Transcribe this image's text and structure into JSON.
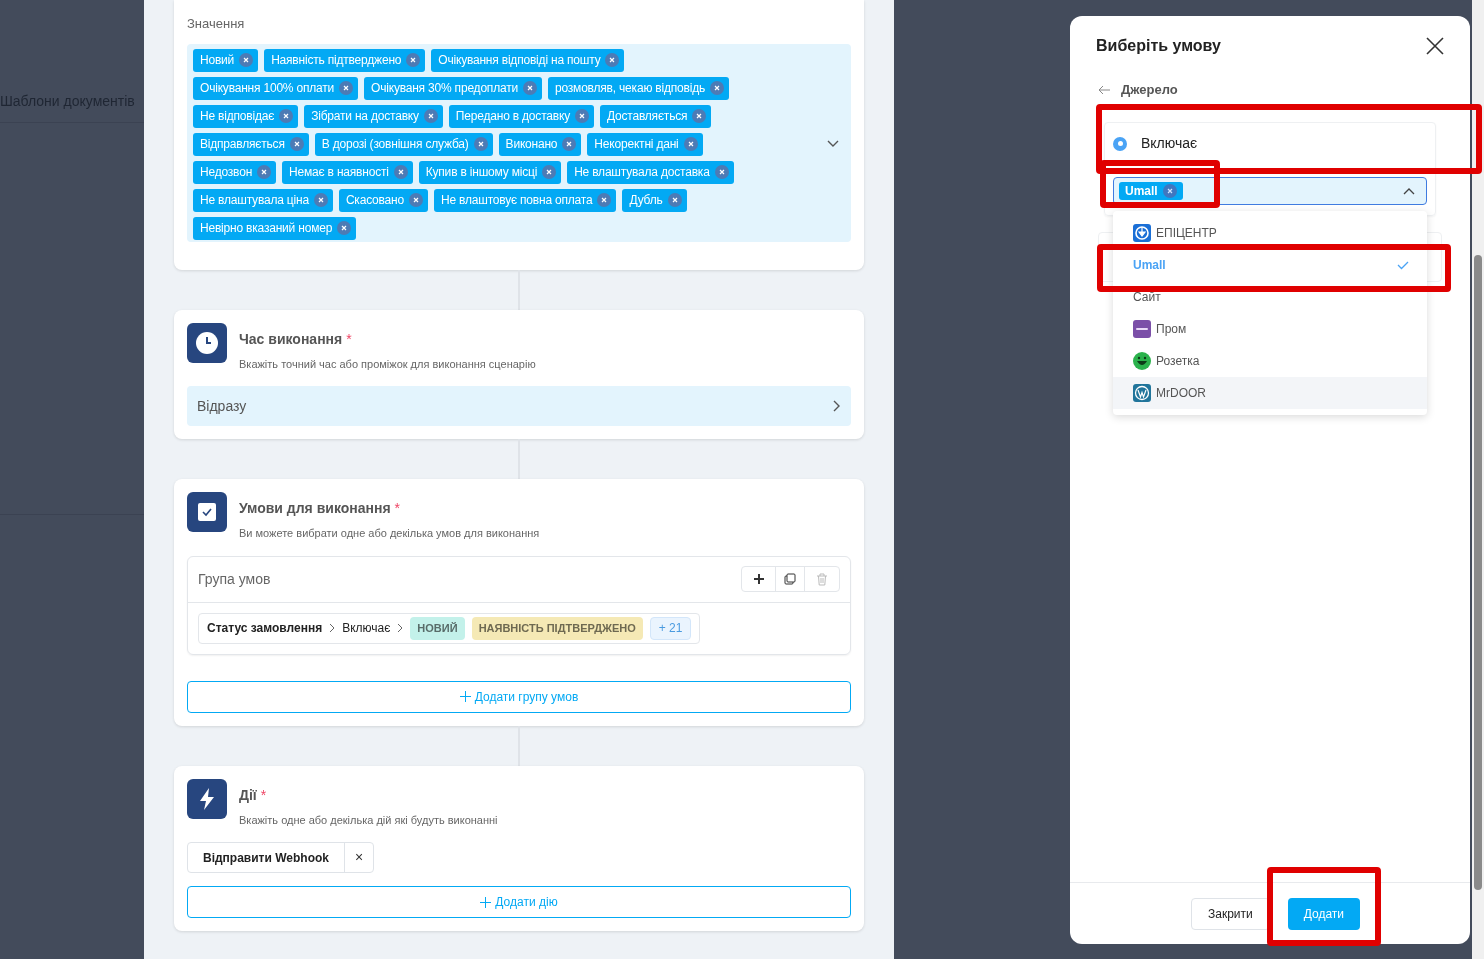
{
  "background": {
    "menu_item": "Шаблони документів"
  },
  "values_card": {
    "label": "Значення",
    "tags": [
      "Новий",
      "Наявність підтверджено",
      "Очікування відповіді на пошту",
      "Очікування 100% оплати",
      "Очікуваня 30% предоплати",
      "розмовляв, чекаю відповідь",
      "Не відповідає",
      "Зібрати на доставку",
      "Передано в доставку",
      "Доставляється",
      "Відправляється",
      "В дорозі (зовнішня служба)",
      "Виконано",
      "Некоректні дані",
      "Недозвон",
      "Немає в наявності",
      "Купив в іншому місці",
      "Не влаштувала доставка",
      "Не влаштувала ціна",
      "Скасовано",
      "Не влаштовує повна оплата",
      "Дубль",
      "Невірно вказаний номер"
    ]
  },
  "time_card": {
    "title": "Час виконання",
    "required": "*",
    "subtitle": "Вкажіть точний час або проміжок для виконання сценарію",
    "value": "Відразу"
  },
  "conditions_card": {
    "title": "Умови для виконання",
    "required": "*",
    "subtitle": "Ви можете вибрати одне або декілька умов для виконання",
    "group_title": "Група умов",
    "condition": {
      "field": "Статус замовлення",
      "operator": "Включає",
      "chips": [
        {
          "label": "НОВИЙ",
          "color": "#c3f1ea"
        },
        {
          "label": "НАЯВНІСТЬ ПІДТВЕРДЖЕНО",
          "color": "#f5e9b5"
        }
      ],
      "more": "+ 21"
    },
    "add_group": "Додати групу умов"
  },
  "actions_card": {
    "title": "Дії",
    "required": "*",
    "subtitle": "Вкажіть одне або декілька дій які будуть виконанні",
    "action": "Відправити Webhook",
    "remove": "×",
    "add_action": "Додати дію"
  },
  "modal": {
    "title": "Виберіть умову",
    "back": "Джерело",
    "option": {
      "label": "Включає",
      "selected": true
    },
    "selected_tags": [
      "Umall"
    ],
    "dropdown": [
      {
        "label": "ЕПІЦЕНТР",
        "kind": "target",
        "selected": false,
        "highlighted": false
      },
      {
        "label": "Umall",
        "kind": "plain",
        "selected": true,
        "highlighted": false
      },
      {
        "label": "Сайт",
        "kind": "plain",
        "selected": false,
        "highlighted": false
      },
      {
        "label": "Пром",
        "kind": "tile",
        "selected": false,
        "highlighted": false
      },
      {
        "label": "Розетка",
        "kind": "smiley",
        "selected": false,
        "highlighted": false
      },
      {
        "label": "MrDOOR",
        "kind": "wordpress",
        "selected": false,
        "highlighted": true
      }
    ],
    "buttons": {
      "close": "Закрити",
      "add": "Додати"
    }
  }
}
